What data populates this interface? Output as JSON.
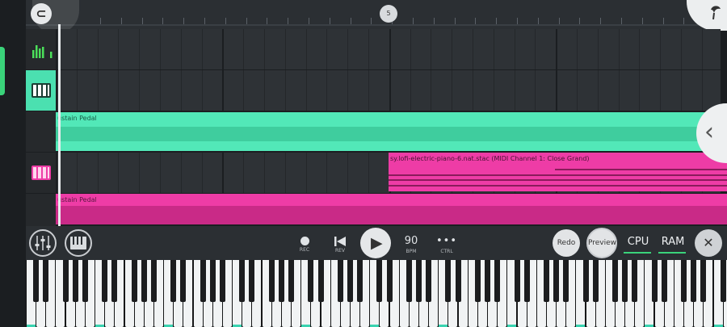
{
  "ruler": {
    "marker_label": "5"
  },
  "tracks": [
    {
      "name": "automation",
      "icon": "level-meter-icon"
    },
    {
      "name": "piano-roll-1",
      "icon": "piano-green-icon"
    },
    {
      "name": "empty",
      "icon": ""
    },
    {
      "name": "piano-roll-2",
      "icon": "piano-pink-icon"
    },
    {
      "name": "empty",
      "icon": ""
    }
  ],
  "clips": {
    "sustain_1": {
      "label": "ustain Pedal",
      "color": "#52e8b8"
    },
    "piano": {
      "label": "sy.lofi-electric-piano-6.nat.stac (MIDI Channel 1: Close Grand)",
      "color": "#ee3ca6"
    },
    "sustain_2": {
      "label": "ustain Pedal",
      "color": "#ee3ca6"
    }
  },
  "transport": {
    "rec": "REC",
    "rev": "REV",
    "bpm_value": "90",
    "bpm": "BPM",
    "ctrl": "CTRL",
    "ctrl_glyph": "•••",
    "redo": "Redo",
    "preview": "Preview",
    "cpu": "CPU",
    "ram": "RAM",
    "close_glyph": "✕"
  },
  "colors": {
    "accent_green": "#3ad37a",
    "clip_teal": "#52e8b8",
    "clip_pink": "#ee3ca6"
  }
}
